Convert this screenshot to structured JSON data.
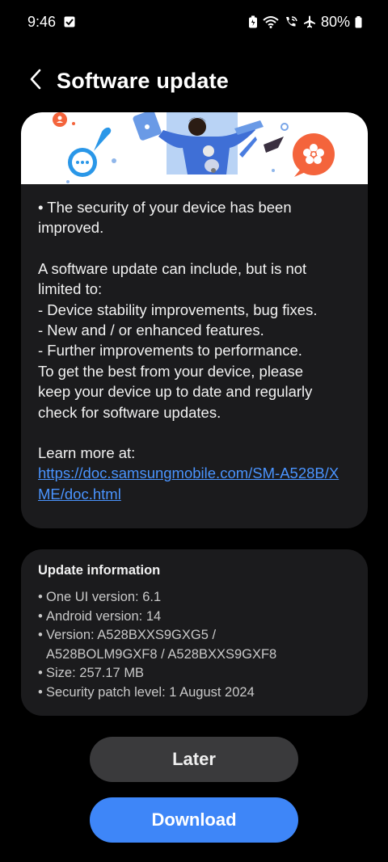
{
  "status_bar": {
    "time": "9:46",
    "battery": "80%",
    "colors": {
      "text": "#ffffff"
    }
  },
  "header": {
    "title": "Software update"
  },
  "release_notes": {
    "line_security": "• The security of your device has been\nimproved.",
    "intro": "A software update can include, but is not\nlimited to:",
    "items": [
      " - Device stability improvements, bug fixes.",
      " - New and / or enhanced features.",
      " - Further improvements to performance."
    ],
    "closing": "To get the best from your device, please\nkeep your device up to date and regularly\ncheck for software updates.",
    "learn_more_label": "Learn more at:",
    "learn_more_link": "https://doc.samsungmobile.com/SM-A528B/XME/doc.html"
  },
  "update_info": {
    "title": "Update information",
    "items": [
      "One UI version: 6.1",
      "Android version: 14",
      "Version: A528BXXS9GXG5 /\nA528BOLM9GXF8 / A528BXXS9GXF8",
      "Size: 257.17 MB",
      "Security patch level: 1 August 2024"
    ]
  },
  "actions": {
    "later_label": "Later",
    "download_label": "Download"
  },
  "theme": {
    "background": "#000000",
    "card": "#1b1b1d",
    "link": "#4a94ff",
    "primary_button": "#3e86f8",
    "secondary_button": "#3a3a3c"
  },
  "icons": [
    "gallery-notification-icon",
    "battery-saver-icon",
    "wifi-icon",
    "wifi-calling-icon",
    "airplane-icon",
    "battery-icon",
    "back-arrow-icon"
  ]
}
